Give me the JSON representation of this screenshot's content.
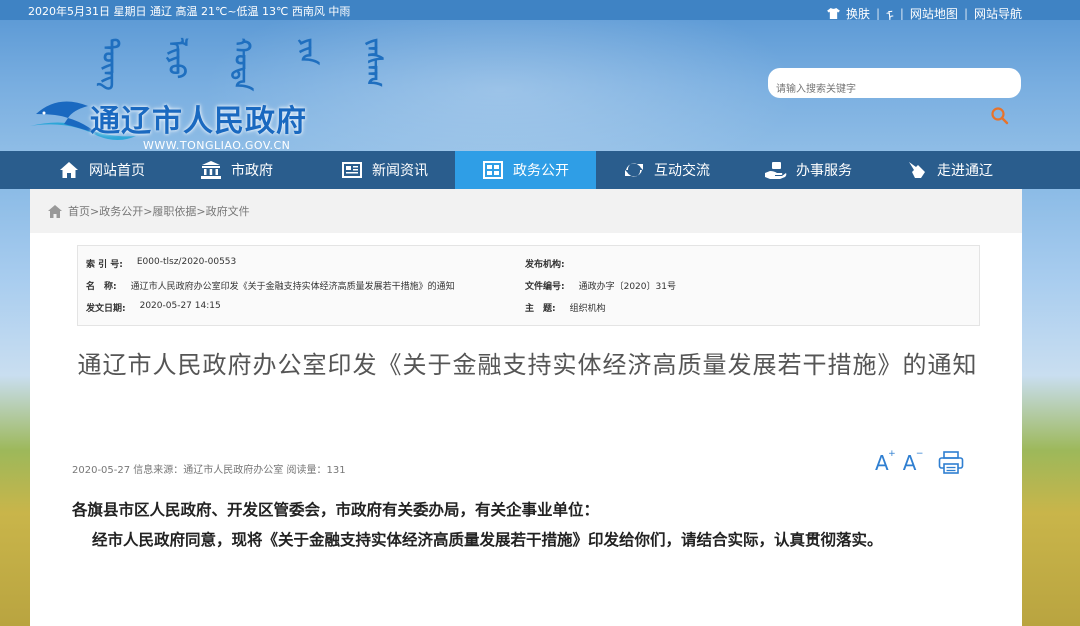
{
  "topbar": {
    "date_weather": "2020年5月31日 星期日 通辽 高温 21℃~低温 13℃ 西南风 中雨",
    "skin_label": "换肤",
    "mongol_label": "ᠮ",
    "sitemap_label": "网站地图",
    "nav_label": "网站导航"
  },
  "header": {
    "mongol_script": [
      "ᠲᠦᠩ",
      "ᠯᠢᠶᠣ",
      "ᠬᠣᠲᠠ",
      "ᠶᠢᠨ",
      "ᠵᠠᠰᠠᠭ"
    ],
    "site_title": "通辽市人民政府",
    "site_url": "WWW.TONGLIAO.GOV.CN",
    "search_placeholder": "请输入搜索关键字"
  },
  "nav": {
    "items": [
      {
        "label": "网站首页",
        "icon": "home-icon"
      },
      {
        "label": "市政府",
        "icon": "government-building-icon"
      },
      {
        "label": "新闻资讯",
        "icon": "newspaper-icon"
      },
      {
        "label": "政务公开",
        "icon": "grid-icon",
        "active": true
      },
      {
        "label": "互动交流",
        "icon": "refresh-arrows-icon"
      },
      {
        "label": "办事服务",
        "icon": "hand-service-icon"
      },
      {
        "label": "走进通辽",
        "icon": "pointer-hand-icon"
      }
    ]
  },
  "breadcrumb": "首页>政务公开>履职依据>政府文件",
  "meta": {
    "index_key": "索 引 号:",
    "index_val": "E000-tlsz/2020-00553",
    "name_key": "名　称:",
    "name_val": "通辽市人民政府办公室印发《关于金融支持实体经济高质量发展若干措施》的通知",
    "date_key": "发文日期:",
    "date_val": "2020-05-27 14:15",
    "org_key": "发布机构:",
    "org_val": "",
    "docno_key": "文件编号:",
    "docno_val": "通政办字〔2020〕31号",
    "subject_key": "主　题:",
    "subject_val": "组织机构"
  },
  "article": {
    "title": "通辽市人民政府办公室印发《关于金融支持实体经济高质量发展若干措施》的通知",
    "info": "2020-05-27 信息来源：通辽市人民政府办公室 阅读量：131",
    "font_increase": "A",
    "font_decrease": "A",
    "salutation": "各旗县市区人民政府、开发区管委会，市政府有关委办局，有关企事业单位：",
    "paragraph": "经市人民政府同意，现将《关于金融支持实体经济高质量发展若干措施》印发给你们，请结合实际，认真贯彻落实。"
  },
  "colors": {
    "nav_bg": "#2a5d8d",
    "nav_active": "#2f9ee6",
    "accent_blue": "#2f7fd1",
    "search_icon": "#e8732a"
  }
}
